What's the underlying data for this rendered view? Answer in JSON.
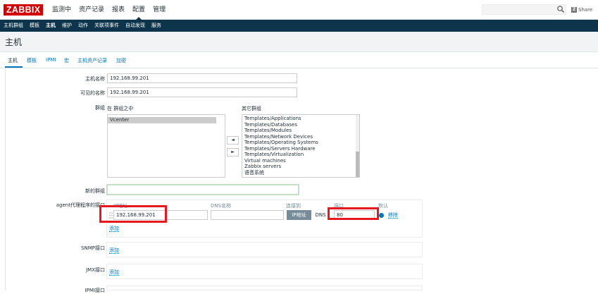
{
  "header": {
    "logo": "ZABBIX",
    "menu": [
      "监测中",
      "资产记录",
      "报表",
      "配置",
      "管理"
    ],
    "selected_menu": "配置",
    "share_label": "Share",
    "search_value": ""
  },
  "submenu": {
    "items": [
      "主机群组",
      "模板",
      "主机",
      "维护",
      "动作",
      "关联项事件",
      "自动发现",
      "服务"
    ],
    "selected": "主机"
  },
  "page": {
    "title": "主机"
  },
  "tabs": [
    "主机",
    "模板",
    "IPMI",
    "宏",
    "主机资产记录",
    "加密"
  ],
  "form": {
    "hostname_label": "主机名称",
    "hostname_value": "192.168.99.201",
    "visible_name_label": "可见的名称",
    "visible_name_value": "192.168.99.201",
    "groups_label": "群组",
    "in_groups_label": "在 群组之中",
    "other_groups_label": "其它群组",
    "in_groups": [
      "Vcenter"
    ],
    "other_groups": [
      "Templates/Applications",
      "Templates/Databases",
      "Templates/Modules",
      "Templates/Network Devices",
      "Templates/Operating Systems",
      "Templates/Servers Hardware",
      "Templates/Virtualization",
      "Virtual machines",
      "Zabbix servers",
      "语音系统"
    ],
    "move_left_label": "◄",
    "move_right_label": "►",
    "new_group_label": "新的群组",
    "new_group_value": "",
    "agent_label": "agent代理程序的接口",
    "col_ip": "IP地址",
    "col_dns": "DNS名称",
    "col_connect": "连接到",
    "col_port": "端口",
    "col_default": "默认",
    "agent_ip_value": "192.168.99.201",
    "agent_dns_value": "",
    "connect_ip_label": "IP地址",
    "connect_dns_label": "DNS",
    "agent_port_value": "80",
    "remove_label": "移除",
    "add_label": "添加",
    "snmp_label": "SNMP接口",
    "jmx_label": "JMX接口",
    "ipmi_label": "IPMI接口"
  },
  "colors": {
    "highlight": "#e5191f",
    "link": "#0275b8",
    "navbar": "#0e344c"
  }
}
